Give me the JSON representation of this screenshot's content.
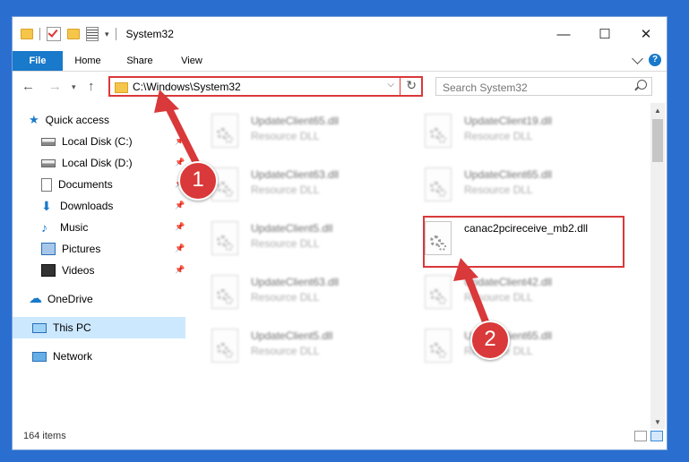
{
  "window": {
    "title": "System32",
    "caption": {
      "minimize": "—",
      "maximize": "☐",
      "close": "✕"
    }
  },
  "ribbon": {
    "tabs": [
      "File",
      "Home",
      "Share",
      "View"
    ],
    "help": "?"
  },
  "navigation": {
    "back": "←",
    "forward": "→",
    "recent": "▾",
    "up": "↑",
    "address": "C:\\Windows\\System32",
    "address_dropdown": "⌵",
    "refresh": "↻",
    "search_placeholder": "Search System32"
  },
  "sidebar": {
    "items": [
      {
        "label": "Quick access",
        "icon": "star-icon",
        "pinned": false
      },
      {
        "label": "Local Disk (C:)",
        "icon": "disk-icon",
        "pinned": true
      },
      {
        "label": "Local Disk (D:)",
        "icon": "disk-icon",
        "pinned": true
      },
      {
        "label": "Documents",
        "icon": "document-icon",
        "pinned": true
      },
      {
        "label": "Downloads",
        "icon": "download-icon",
        "pinned": true
      },
      {
        "label": "Music",
        "icon": "music-icon",
        "pinned": true
      },
      {
        "label": "Pictures",
        "icon": "pictures-icon",
        "pinned": true
      },
      {
        "label": "Videos",
        "icon": "videos-icon",
        "pinned": true
      },
      {
        "label": "OneDrive",
        "icon": "cloud-icon",
        "pinned": false
      },
      {
        "label": "This PC",
        "icon": "computer-icon",
        "pinned": false,
        "selected": true
      },
      {
        "label": "Network",
        "icon": "network-icon",
        "pinned": false
      }
    ]
  },
  "files": [
    {
      "name": "UpdateClient65.dll",
      "type": "Resource DLL",
      "blurred": true
    },
    {
      "name": "UpdateClient19.dll",
      "type": "Resource DLL",
      "blurred": true
    },
    {
      "name": "UpdateClient63.dll",
      "type": "Resource DLL",
      "blurred": true
    },
    {
      "name": "UpdateClient65.dll",
      "type": "Resource DLL",
      "blurred": true
    },
    {
      "name": "UpdateClient5.dll",
      "type": "Resource DLL",
      "blurred": true
    },
    {
      "name": "canac2pcireceive_mb2.dll",
      "type": "",
      "blurred": false
    },
    {
      "name": "UpdateClient63.dll",
      "type": "Resource DLL",
      "blurred": true
    },
    {
      "name": "UpdateClient42.dll",
      "type": "Resource DLL",
      "blurred": true
    },
    {
      "name": "UpdateClient5.dll",
      "type": "Resource DLL",
      "blurred": true
    },
    {
      "name": "UpdateClient65.dll",
      "type": "Resource DLL",
      "blurred": true
    }
  ],
  "status": {
    "item_count": "164 items"
  },
  "callouts": {
    "first": "1",
    "second": "2"
  },
  "colors": {
    "accent": "#1979ca",
    "callout": "#d9393a",
    "selection": "#cce8ff"
  }
}
